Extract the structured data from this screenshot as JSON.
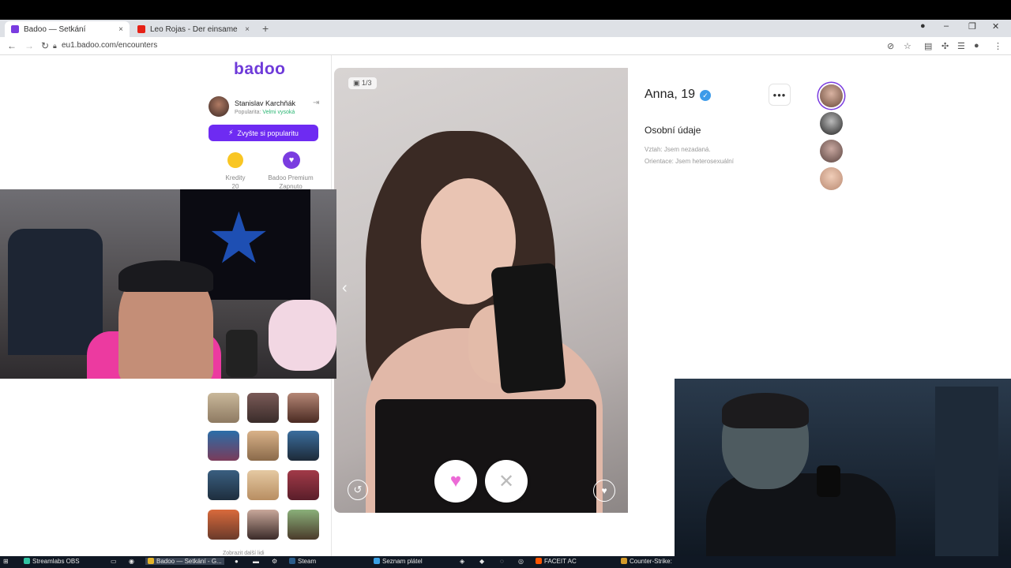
{
  "browser": {
    "tabs": [
      {
        "title": "Badoo — Setkání",
        "close": "×"
      },
      {
        "title": "Leo Rojas - Der einsame Hirte (V",
        "close": "×"
      }
    ],
    "new_tab": "+",
    "url": "eu1.badoo.com/encounters",
    "window_controls": {
      "minimize": "–",
      "restore": "❐",
      "close": "✕"
    }
  },
  "sidebar": {
    "logo": "badoo",
    "user": {
      "name": "Stanislav Karchňák",
      "popularity_label": "Popularita:",
      "popularity_value": "Velmi vysoká"
    },
    "boost_button": "Zvyšte si popularitu",
    "credits": {
      "label": "Kredity",
      "value": "20"
    },
    "premium": {
      "label": "Badoo Premium",
      "status": "Zapnuto"
    },
    "bottom_link": "Zobrazit další lidi"
  },
  "profile": {
    "name": "Anna, 19",
    "photo_counter": "1/3",
    "section_title": "Osobní údaje",
    "details": [
      "Vztah: Jsem nezadaná.",
      "Orientace: Jsem heterosexuální"
    ]
  },
  "taskbar": {
    "items": [
      "Streamlabs OBS",
      "Badoo — Setkání - G...",
      "Steam",
      "Seznam plátel",
      "FACEIT AC",
      "Counter-Strike:"
    ]
  },
  "colors": {
    "accent": "#6e2bf2",
    "brand": "#6e3ad9",
    "like": "#ec6ad6",
    "verified": "#3d9be9",
    "popularity": "#2bb673"
  },
  "icons": {
    "verified": "check-badge",
    "like": "heart",
    "pass": "cross",
    "undo": "undo-arrow",
    "superlike": "heart-sparkle",
    "more": "ellipsis"
  }
}
